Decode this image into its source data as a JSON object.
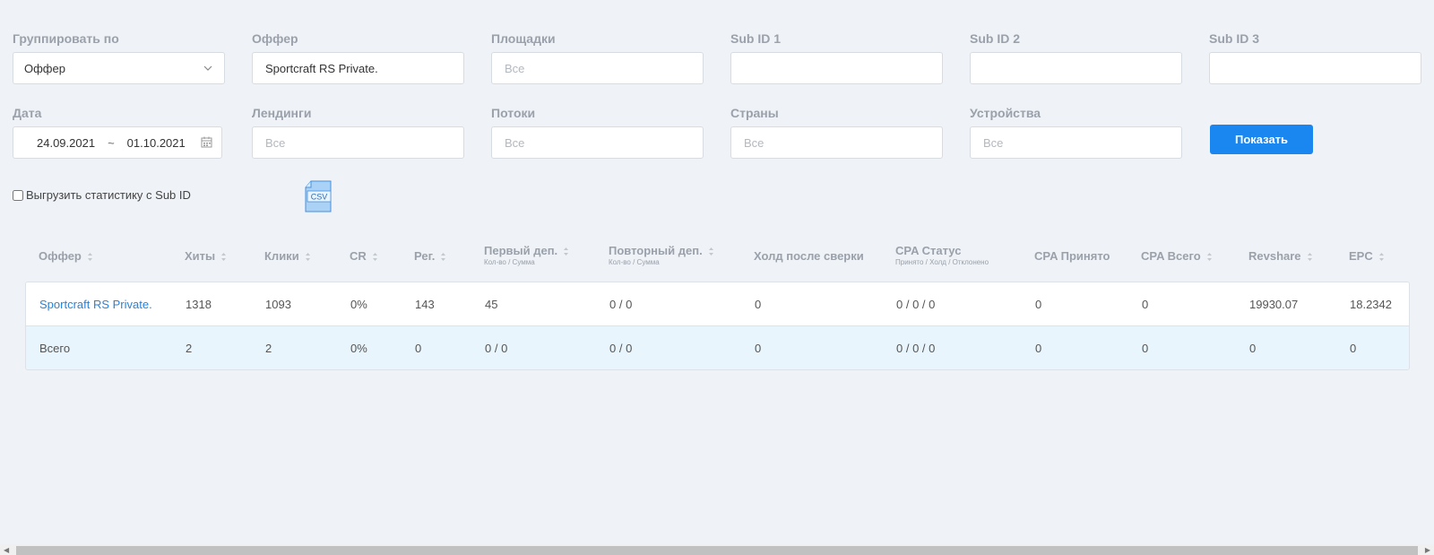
{
  "filters": {
    "group_by": {
      "label": "Группировать по",
      "value": "Оффер"
    },
    "offer": {
      "label": "Оффер",
      "value": "Sportcraft RS Private."
    },
    "platforms": {
      "label": "Площадки",
      "placeholder": "Все"
    },
    "sub1": {
      "label": "Sub ID 1",
      "value": ""
    },
    "sub2": {
      "label": "Sub ID 2",
      "value": ""
    },
    "sub3": {
      "label": "Sub ID 3",
      "value": ""
    },
    "date": {
      "label": "Дата",
      "from": "24.09.2021",
      "sep": "~",
      "to": "01.10.2021"
    },
    "landings": {
      "label": "Лендинги",
      "placeholder": "Все"
    },
    "streams": {
      "label": "Потоки",
      "placeholder": "Все"
    },
    "countries": {
      "label": "Страны",
      "placeholder": "Все"
    },
    "devices": {
      "label": "Устройства",
      "placeholder": "Все"
    },
    "show_button": "Показать"
  },
  "export": {
    "checkbox_label": "Выгрузить статистику с Sub ID",
    "csv_label": "CSV"
  },
  "table": {
    "headers": [
      {
        "label": "Оффер",
        "sub": ""
      },
      {
        "label": "Хиты",
        "sub": ""
      },
      {
        "label": "Клики",
        "sub": ""
      },
      {
        "label": "CR",
        "sub": ""
      },
      {
        "label": "Рег.",
        "sub": ""
      },
      {
        "label": "Первый деп.",
        "sub": "Кол-во / Сумма"
      },
      {
        "label": "Повторный деп.",
        "sub": "Кол-во / Сумма"
      },
      {
        "label": "Холд после сверки",
        "sub": ""
      },
      {
        "label": "CPA Статус",
        "sub": "Принято / Холд / Отклонено"
      },
      {
        "label": "CPA Принято",
        "sub": ""
      },
      {
        "label": "CPA Всего",
        "sub": ""
      },
      {
        "label": "Revshare",
        "sub": ""
      },
      {
        "label": "EPC",
        "sub": ""
      }
    ],
    "rows": [
      [
        "Sportcraft RS Private.",
        "1318",
        "1093",
        "0%",
        "143",
        "45",
        "0 / 0",
        "0",
        "0 / 0 / 0",
        "0",
        "0",
        "19930.07",
        "18.2342"
      ],
      [
        "Всего",
        "2",
        "2",
        "0%",
        "0",
        "0 / 0",
        "0 / 0",
        "0",
        "0 / 0 / 0",
        "0",
        "0",
        "0",
        "0"
      ]
    ]
  },
  "colors": {
    "accent": "#1a87f0",
    "link": "#2a82d8",
    "total_row_bg": "#e8f5fc",
    "page_bg": "#eff2f6"
  }
}
